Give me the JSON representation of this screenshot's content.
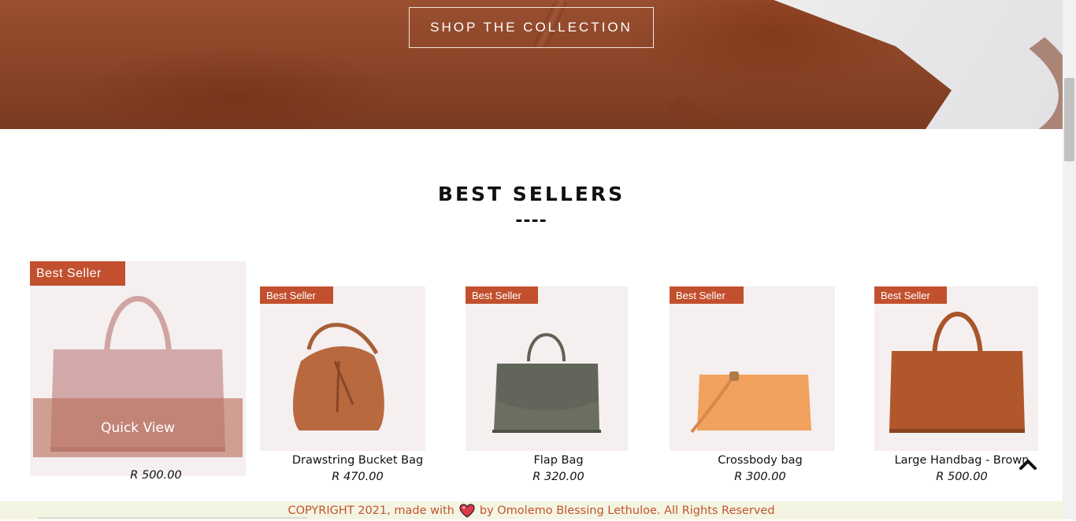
{
  "hero": {
    "cta_label": "SHOP THE COLLECTION"
  },
  "best_sellers": {
    "title": "BEST SELLERS",
    "divider": "----",
    "badge_label": "Best Seller",
    "quick_view_label": "Quick View",
    "products": [
      {
        "name": "",
        "price": "R 500.00",
        "color": "#d2a7a7"
      },
      {
        "name": "Drawstring Bucket Bag",
        "price": "R 470.00",
        "color": "#b96a3f"
      },
      {
        "name": "Flap Bag",
        "price": "R 320.00",
        "color": "#6b6f60"
      },
      {
        "name": "Crossbody bag",
        "price": "R 300.00",
        "color": "#f0a25e"
      },
      {
        "name": "Large Handbag - Brown",
        "price": "R 500.00",
        "color": "#b0582c"
      }
    ]
  },
  "footer": {
    "prefix": "COPYRIGHT 2021, made with",
    "suffix": "by Omolemo Blessing Lethuloe. All Rights Reserved"
  },
  "icons": {
    "scroll_top": "chevron-up-icon",
    "love": "heart-icon"
  },
  "colors": {
    "accent": "#c2502e",
    "footer_bg": "#f4f4e2",
    "card_bg": "#f5efef"
  }
}
